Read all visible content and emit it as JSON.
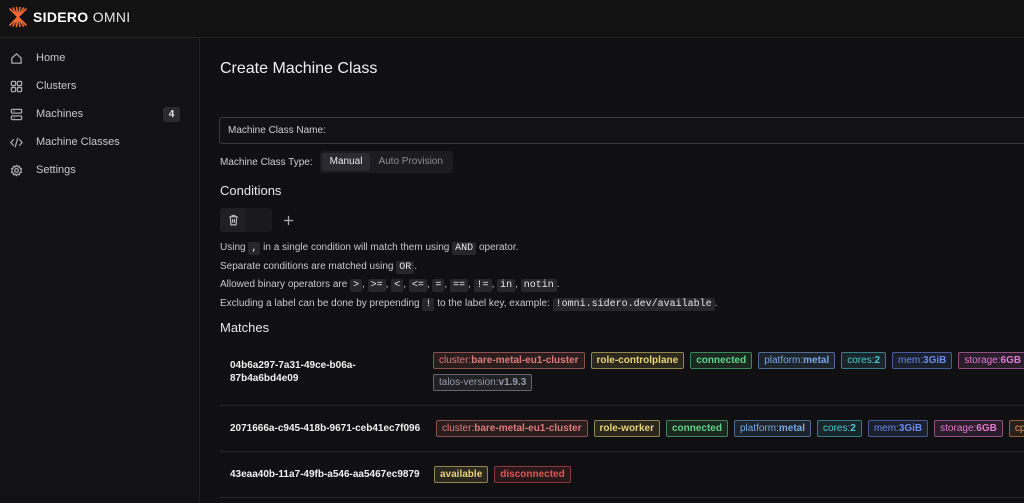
{
  "brand": {
    "name_bold": "SIDERO",
    "name_light": "OMNI"
  },
  "sidebar": {
    "items": [
      {
        "label": "Home",
        "icon": "home-icon"
      },
      {
        "label": "Clusters",
        "icon": "clusters-icon"
      },
      {
        "label": "Machines",
        "icon": "server-icon",
        "badge": "4"
      },
      {
        "label": "Machine Classes",
        "icon": "code-icon"
      },
      {
        "label": "Settings",
        "icon": "gear-icon"
      }
    ]
  },
  "page": {
    "title": "Create Machine Class",
    "name_field_label": "Machine Class Name:",
    "name_field_value": "",
    "type_label": "Machine Class Type:",
    "type_options": [
      "Manual",
      "Auto Provision"
    ],
    "type_selected": "Manual",
    "conditions_heading": "Conditions",
    "help": {
      "l1_a": "Using",
      "l1_code": ",",
      "l1_b": "in a single condition will match them using",
      "l1_code2": "AND",
      "l1_c": "operator.",
      "l2_a": "Separate conditions are matched using",
      "l2_code": "OR",
      "l2_b": ".",
      "l3_a": "Allowed binary operators are",
      "ops": [
        ">",
        ">=",
        "<",
        "<=",
        "=",
        "==",
        "!=",
        "in",
        "notin"
      ],
      "l3_end": ".",
      "l4_a": "Excluding a label can be done by prepending",
      "l4_code": "!",
      "l4_b": "to the label key, example:",
      "l4_code2": "!omni.sidero.dev/available",
      "l4_c": "."
    },
    "matches_heading": "Matches"
  },
  "label_colors": {
    "cluster": "#e07a7a",
    "role": "#e8d275",
    "connected": "#5fd48b",
    "platform": "#78a9e6",
    "cores": "#4fc7d4",
    "mem": "#6a8cf0",
    "storage": "#e07ad4",
    "talos": "#9a9ab0",
    "available": "#e8d275",
    "disconnected": "#e05555",
    "cpu": "#e8935a"
  },
  "matches": [
    {
      "id": "04b6a297-7a31-49ce-b06a-87b4a6bd4e09",
      "labels": [
        {
          "key": "cluster:",
          "val": "bare-metal-eu1-cluster",
          "color": "cluster"
        },
        {
          "key": "",
          "val": "role-controlplane",
          "color": "role"
        },
        {
          "key": "",
          "val": "connected",
          "color": "connected"
        },
        {
          "key": "platform:",
          "val": "metal",
          "color": "platform"
        },
        {
          "key": "cores:",
          "val": "2",
          "color": "cores"
        },
        {
          "key": "mem:",
          "val": "3GiB",
          "color": "mem"
        },
        {
          "key": "storage:",
          "val": "6GB",
          "color": "storage"
        },
        {
          "key": "talos-version:",
          "val": "v1.9.3",
          "color": "talos"
        }
      ]
    },
    {
      "id": "2071666a-c945-418b-9671-ceb41ec7f096",
      "labels": [
        {
          "key": "cluster:",
          "val": "bare-metal-eu1-cluster",
          "color": "cluster"
        },
        {
          "key": "",
          "val": "role-worker",
          "color": "role"
        },
        {
          "key": "",
          "val": "connected",
          "color": "connected"
        },
        {
          "key": "platform:",
          "val": "metal",
          "color": "platform"
        },
        {
          "key": "cores:",
          "val": "2",
          "color": "cores"
        },
        {
          "key": "mem:",
          "val": "3GiB",
          "color": "mem"
        },
        {
          "key": "storage:",
          "val": "6GB",
          "color": "storage"
        },
        {
          "key": "cp",
          "val": "",
          "color": "cpu"
        }
      ]
    },
    {
      "id": "43eaa40b-11a7-49fb-a546-aa5467ec9879",
      "labels": [
        {
          "key": "",
          "val": "available",
          "color": "available"
        },
        {
          "key": "",
          "val": "disconnected",
          "color": "disconnected"
        }
      ]
    }
  ]
}
